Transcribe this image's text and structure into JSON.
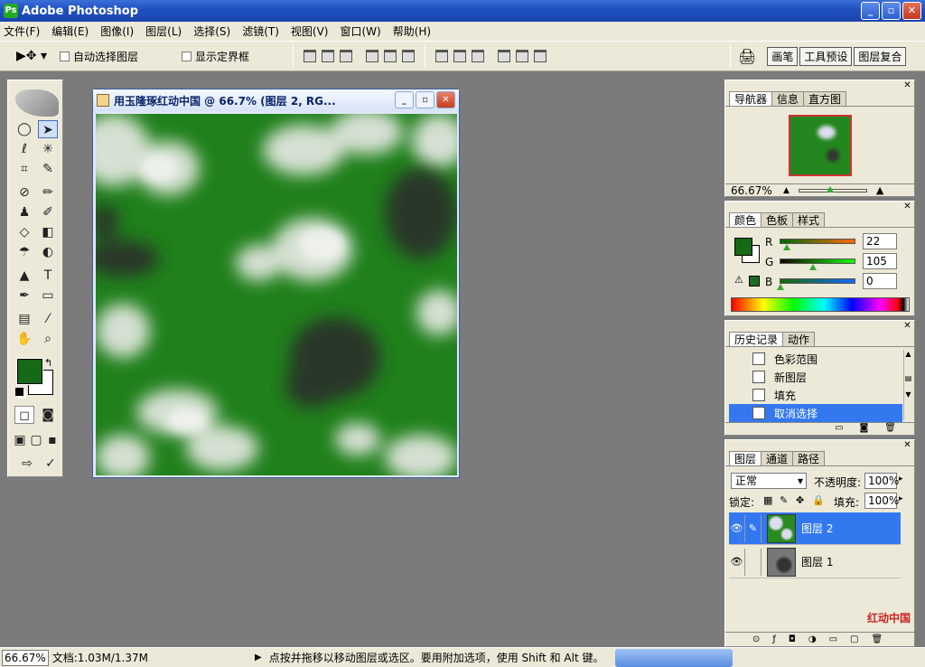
{
  "app": {
    "title": "Adobe Photoshop"
  },
  "menu": [
    "文件(F)",
    "编辑(E)",
    "图像(I)",
    "图层(L)",
    "选择(S)",
    "滤镜(T)",
    "视图(V)",
    "窗口(W)",
    "帮助(H)"
  ],
  "options": {
    "auto_select": "自动选择图层",
    "show_bounds": "显示定界框",
    "tabs": [
      "画笔",
      "工具预设",
      "图层复合"
    ]
  },
  "document": {
    "title": "用玉隆琢红动中国 @ 66.7% (图层 2, RG..."
  },
  "navigator": {
    "tabs": [
      "导航器",
      "信息",
      "直方图"
    ],
    "zoom": "66.67%"
  },
  "color": {
    "tabs": [
      "颜色",
      "色板",
      "样式"
    ],
    "r_label": "R",
    "g_label": "G",
    "b_label": "B",
    "r": "22",
    "g": "105",
    "b": "0",
    "fg_color": "#166916"
  },
  "history": {
    "tabs": [
      "历史记录",
      "动作"
    ],
    "items": [
      "色彩范围",
      "新图层",
      "填充",
      "取消选择"
    ]
  },
  "layers": {
    "tabs": [
      "图层",
      "通道",
      "路径"
    ],
    "blend_mode": "正常",
    "opacity_label": "不透明度:",
    "opacity": "100%",
    "lock_label": "锁定:",
    "fill_label": "填充:",
    "fill": "100%",
    "items": [
      "图层 2",
      "图层 1"
    ]
  },
  "status": {
    "zoom": "66.67%",
    "doc_size": "文档:1.03M/1.37M",
    "hint": "点按并拖移以移动图层或选区。要用附加选项，使用 Shift 和 Alt 键。"
  },
  "watermark": {
    "text": "红动中国"
  }
}
